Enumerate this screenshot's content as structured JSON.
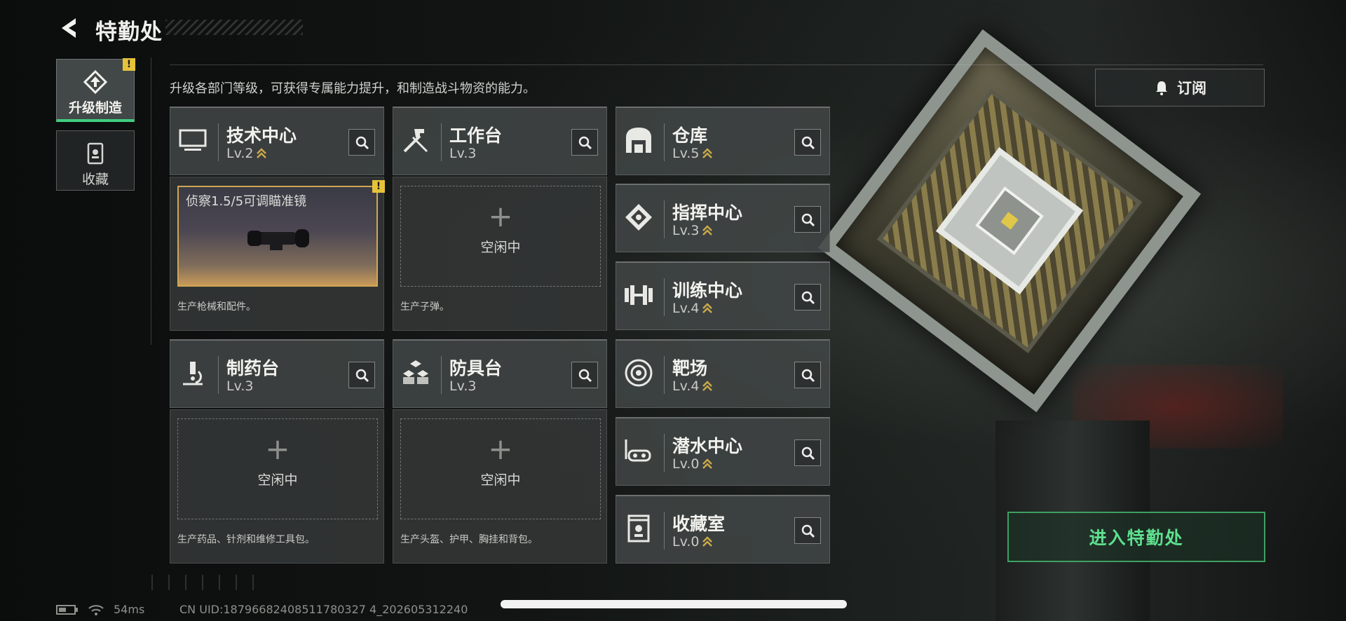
{
  "header": {
    "title": "特勤处"
  },
  "sidebar": {
    "tabs": [
      {
        "label": "升级制造",
        "icon": "upgrade-icon"
      },
      {
        "label": "收藏",
        "icon": "collection-icon"
      }
    ]
  },
  "subtitle": "升级各部门等级，可获得专属能力提升，和制造战斗物资的能力。",
  "subscribe": {
    "label": "订阅",
    "icon": "bell-icon"
  },
  "departments": [
    {
      "name": "技术中心",
      "level": "Lv.2",
      "icon": "monitor-icon"
    },
    {
      "name": "工作台",
      "level": "Lv.3",
      "icon": "hammer-wrench-icon"
    },
    {
      "name": "仓库",
      "level": "Lv.5",
      "icon": "warehouse-icon"
    },
    {
      "name": "指挥中心",
      "level": "Lv.3",
      "icon": "command-icon"
    },
    {
      "name": "训练中心",
      "level": "Lv.4",
      "icon": "dumbbell-icon"
    },
    {
      "name": "制药台",
      "level": "Lv.3",
      "icon": "microscope-icon"
    },
    {
      "name": "防具台",
      "level": "Lv.3",
      "icon": "armor-boxes-icon"
    },
    {
      "name": "靶场",
      "level": "Lv.4",
      "icon": "target-icon"
    },
    {
      "name": "潜水中心",
      "level": "Lv.0",
      "icon": "diving-mask-icon"
    },
    {
      "name": "收藏室",
      "level": "Lv.0",
      "icon": "collection-room-icon"
    }
  ],
  "production": [
    {
      "item": "侦察1.5/5可调瞄准镜",
      "desc": "生产枪械和配件。"
    },
    {
      "idle": "空闲中",
      "desc": "生产子弹。"
    },
    {
      "idle": "空闲中",
      "desc": "生产药品、针剂和维修工具包。"
    },
    {
      "idle": "空闲中",
      "desc": "生产头盔、护甲、胸挂和背包。"
    }
  ],
  "enter_button": {
    "label": "进入特勤处"
  },
  "status_bar": {
    "ping": "54ms",
    "uid": "CN UID:18796682408511780327 4_202605312240"
  },
  "alert_badge": "!",
  "colors": {
    "accent_green": "#3ea062",
    "alert_yellow": "#e6c23a",
    "level_chevron": "#c9a94a"
  }
}
